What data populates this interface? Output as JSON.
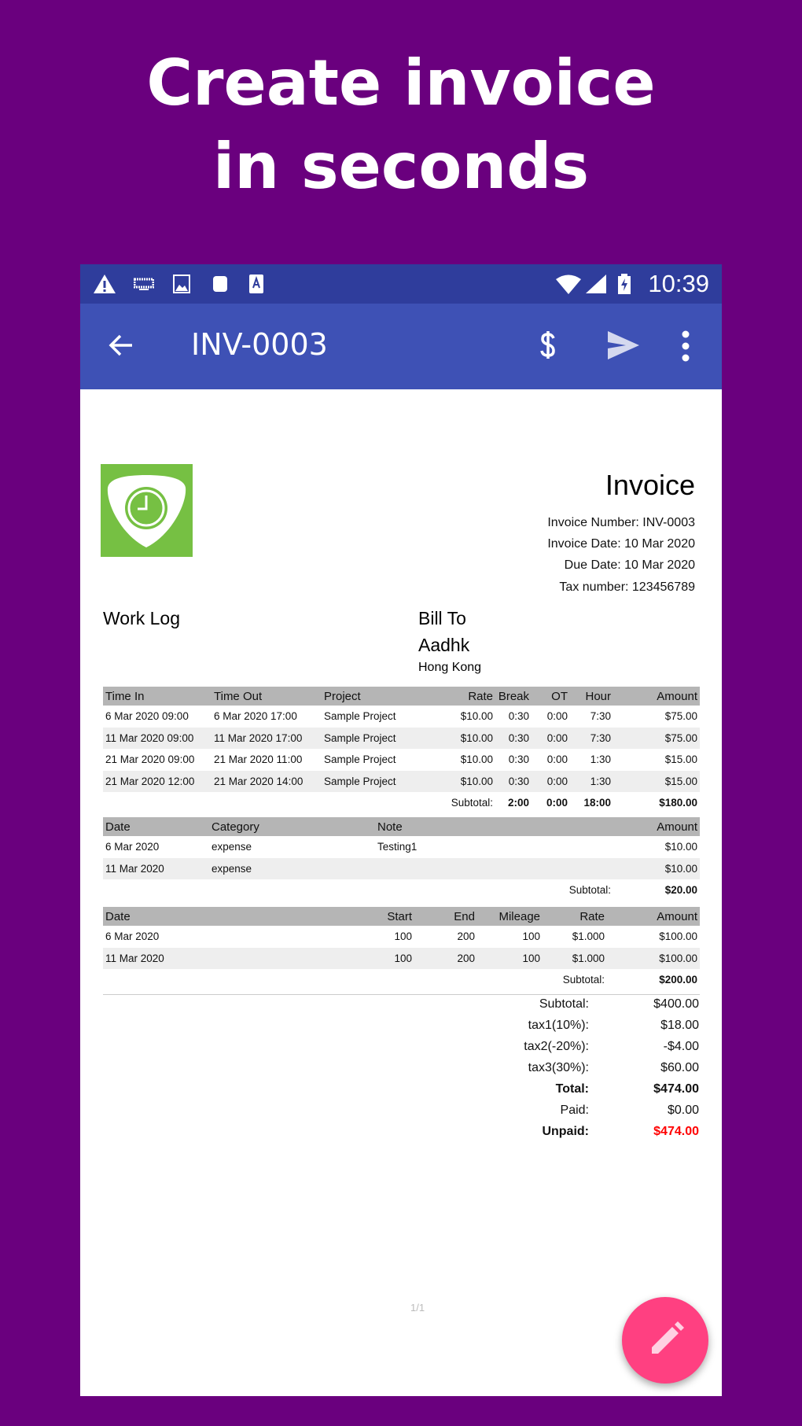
{
  "headline": [
    "Create invoice",
    "in seconds"
  ],
  "status_bar": {
    "time": "10:39"
  },
  "app_bar": {
    "title": "INV-0003"
  },
  "invoice": {
    "title": "Invoice",
    "meta": [
      "Invoice Number: INV-0003",
      "Invoice Date: 10 Mar 2020",
      "Due Date: 10 Mar 2020",
      "Tax number: 123456789"
    ],
    "from": "Work Log",
    "bill_to_label": "Bill To",
    "client": "Aadhk",
    "client_address": "Hong Kong"
  },
  "time_table": {
    "headers": [
      "Time In",
      "Time Out",
      "Project",
      "Rate",
      "Break",
      "OT",
      "Hour",
      "Amount"
    ],
    "rows": [
      [
        "6 Mar 2020 09:00",
        "6 Mar 2020 17:00",
        "Sample Project",
        "$10.00",
        "0:30",
        "0:00",
        "7:30",
        "$75.00"
      ],
      [
        "11 Mar 2020 09:00",
        "11 Mar 2020 17:00",
        "Sample Project",
        "$10.00",
        "0:30",
        "0:00",
        "7:30",
        "$75.00"
      ],
      [
        "21 Mar 2020 09:00",
        "21 Mar 2020 11:00",
        "Sample Project",
        "$10.00",
        "0:30",
        "0:00",
        "1:30",
        "$15.00"
      ],
      [
        "21 Mar 2020 12:00",
        "21 Mar 2020 14:00",
        "Sample Project",
        "$10.00",
        "0:30",
        "0:00",
        "1:30",
        "$15.00"
      ]
    ],
    "subtotal": {
      "label": "Subtotal:",
      "break": "2:00",
      "ot": "0:00",
      "hour": "18:00",
      "amount": "$180.00"
    }
  },
  "expense_table": {
    "headers": [
      "Date",
      "Category",
      "Note",
      "Amount"
    ],
    "rows": [
      [
        "6 Mar 2020",
        "expense",
        "Testing1",
        "$10.00"
      ],
      [
        "11 Mar 2020",
        "expense",
        "",
        "$10.00"
      ]
    ],
    "subtotal": {
      "label": "Subtotal:",
      "amount": "$20.00"
    }
  },
  "mileage_table": {
    "headers": [
      "Date",
      "Start",
      "End",
      "Mileage",
      "Rate",
      "Amount"
    ],
    "rows": [
      [
        "6 Mar 2020",
        "100",
        "200",
        "100",
        "$1.000",
        "$100.00"
      ],
      [
        "11 Mar 2020",
        "100",
        "200",
        "100",
        "$1.000",
        "$100.00"
      ]
    ],
    "subtotal": {
      "label": "Subtotal:",
      "amount": "$200.00"
    }
  },
  "totals": [
    {
      "label": "Subtotal:",
      "value": "$400.00"
    },
    {
      "label": "tax1(10%):",
      "value": "$18.00"
    },
    {
      "label": "tax2(-20%):",
      "value": "-$4.00"
    },
    {
      "label": "tax3(30%):",
      "value": "$60.00"
    },
    {
      "label": "Total:",
      "value": "$474.00",
      "bold": true
    },
    {
      "label": "Paid:",
      "value": "$0.00"
    },
    {
      "label": "Unpaid:",
      "value": "$474.00",
      "bold": true,
      "color": "#ff0000"
    }
  ],
  "pager": "1/1",
  "colors": {
    "background": "#6a007e",
    "status_bar": "#2f3d9c",
    "app_bar": "#3e51b5",
    "fab": "#ff4081",
    "logo": "#76c043"
  }
}
